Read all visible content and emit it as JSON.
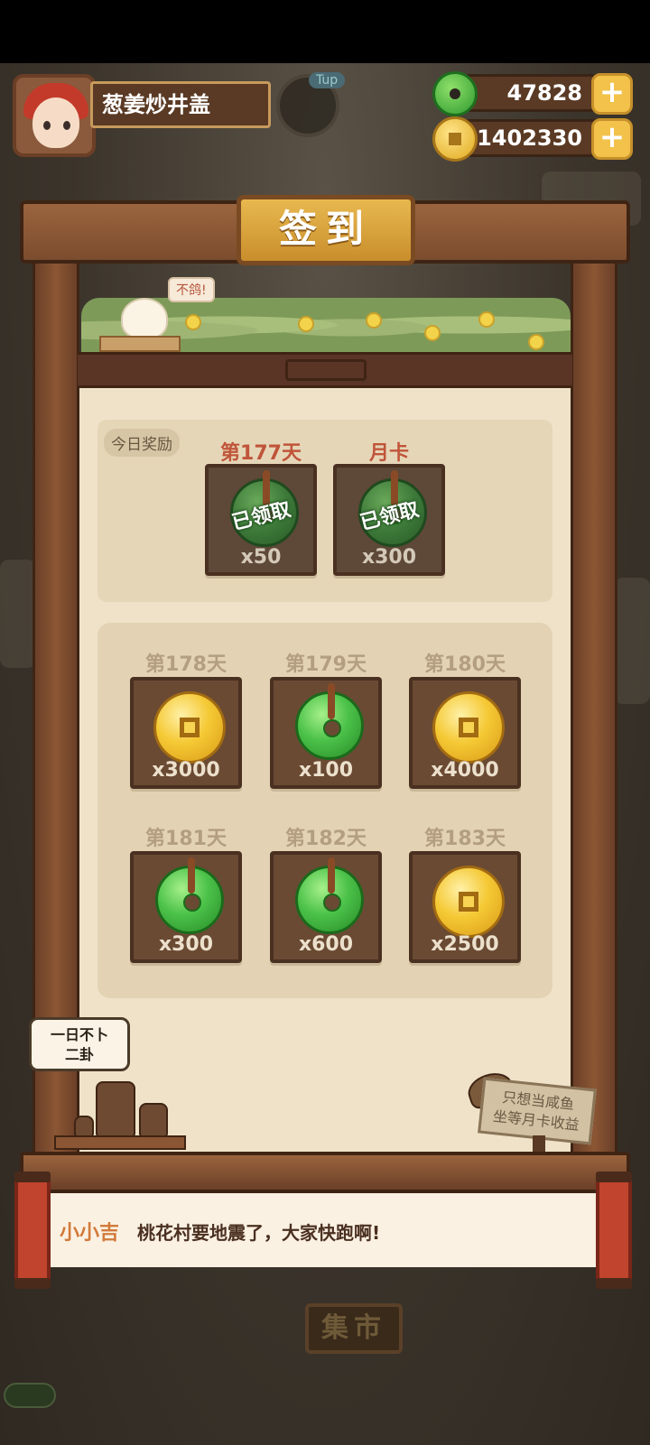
{
  "header": {
    "player_name": "葱姜炒井盖",
    "jade_amount": "47828",
    "coin_amount": "1402330",
    "ghost_tag": "Tup"
  },
  "title": "签到",
  "chick_speech": "不鸽!",
  "today": {
    "tag": "今日奖励",
    "rewards": [
      {
        "label": "第177天",
        "type": "jade",
        "qty": "x50",
        "claimed_text": "已领取"
      },
      {
        "label": "月卡",
        "type": "jade",
        "qty": "x300",
        "claimed_text": "已领取"
      }
    ]
  },
  "upcoming": [
    {
      "label": "第178天",
      "type": "coin",
      "qty": "x3000"
    },
    {
      "label": "第179天",
      "type": "jade",
      "qty": "x100"
    },
    {
      "label": "第180天",
      "type": "coin",
      "qty": "x4000"
    },
    {
      "label": "第181天",
      "type": "jade",
      "qty": "x300"
    },
    {
      "label": "第182天",
      "type": "jade",
      "qty": "x600"
    },
    {
      "label": "第183天",
      "type": "coin",
      "qty": "x2500"
    }
  ],
  "bubble_line1": "一日不卜",
  "bubble_line2": "二卦",
  "sign_line1": "只想当咸鱼",
  "sign_line2": "坐等月卡收益",
  "dialog": {
    "speaker": "小小吉",
    "text": "桃花村要地震了，大家快跑啊!"
  },
  "market_label": "集市",
  "colors": {
    "jade": "#4cc24a",
    "coin": "#f5c935",
    "accent_red": "#c0553a"
  }
}
